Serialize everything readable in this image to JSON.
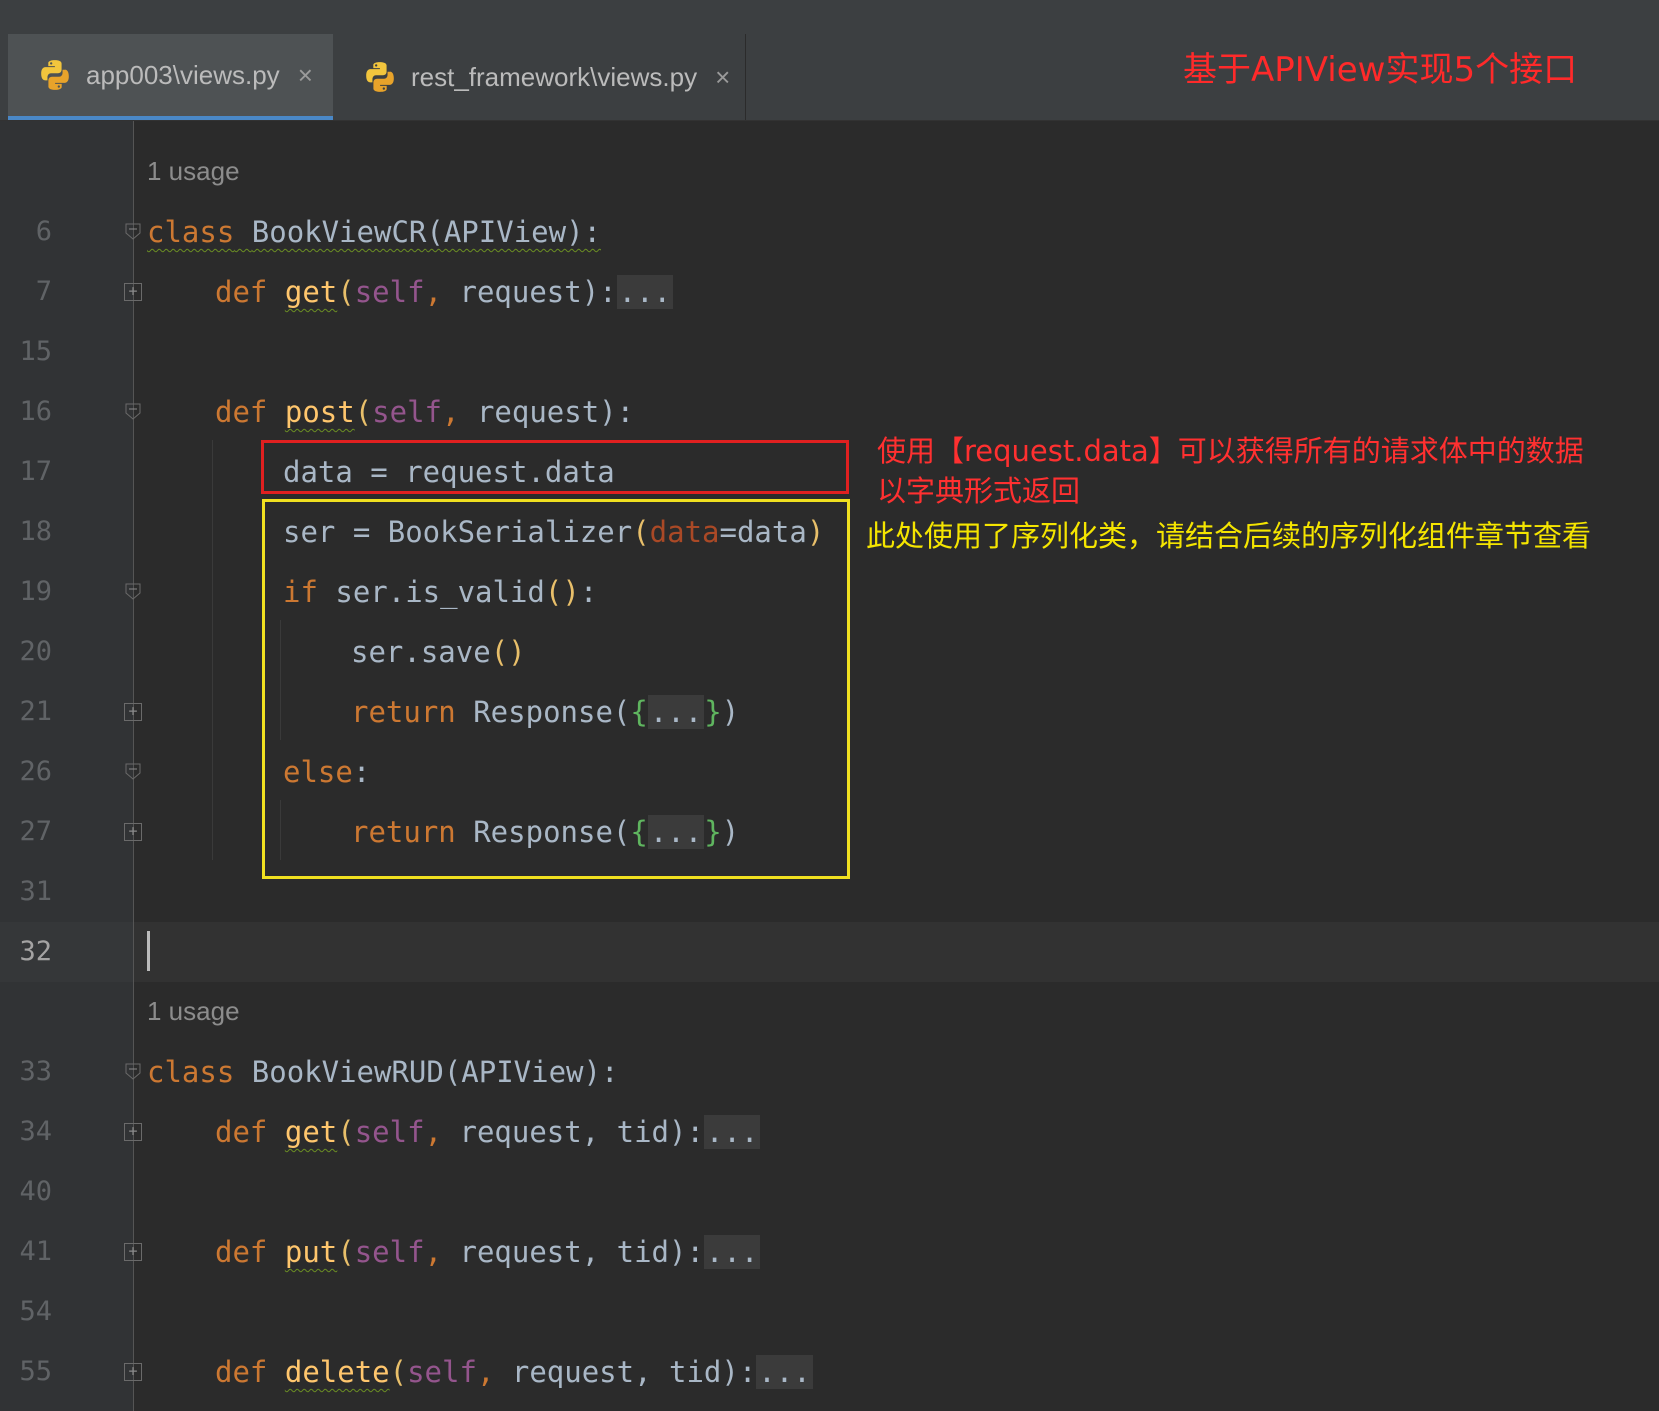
{
  "tabs": [
    {
      "label": "app003\\views.py",
      "close": "×"
    },
    {
      "label": "rest_framework\\views.py",
      "close": "×"
    }
  ],
  "title_note": "基于APIView实现5个接口",
  "usage_hint": "1 usage",
  "line_numbers": [
    "6",
    "7",
    "15",
    "16",
    "17",
    "18",
    "19",
    "20",
    "21",
    "26",
    "27",
    "31",
    "32",
    "33",
    "34",
    "40",
    "41",
    "54",
    "55"
  ],
  "code": {
    "l6": {
      "kw": "class",
      "name": "BookViewCR",
      "base": "(APIView):"
    },
    "l7": {
      "kw": "def",
      "fn": "get",
      "open": "(",
      "self": "self",
      "sep": ", ",
      "args": "request):",
      "ph": "..."
    },
    "l16": {
      "kw": "def",
      "fn": "post",
      "open": "(",
      "self": "self",
      "sep": ", ",
      "args": "request):"
    },
    "l17": "data = request.data",
    "l18": {
      "pre": "ser = BookSerializer",
      "open": "(",
      "param": "data",
      "eq": "=data",
      "close": ")"
    },
    "l19": {
      "kw": "if",
      "rest": " ser.is_valid",
      "parens": "()",
      "colon": ":"
    },
    "l20": {
      "text": "ser.save",
      "parens": "()"
    },
    "l21": {
      "kw": "return",
      "fn": " Response(",
      "lb": "{",
      "ph": "...",
      "rb": "}",
      "end": ")"
    },
    "l26": {
      "kw": "else",
      "colon": ":"
    },
    "l27": {
      "kw": "return",
      "fn": " Response(",
      "lb": "{",
      "ph": "...",
      "rb": "}",
      "end": ")"
    },
    "l33": {
      "kw": "class",
      "name": "BookViewRUD",
      "base": "(APIView):"
    },
    "l34": {
      "kw": "def",
      "fn": "get",
      "open": "(",
      "self": "self",
      "sep": ", ",
      "args": "request, tid):",
      "ph": "..."
    },
    "l41": {
      "kw": "def",
      "fn": "put",
      "open": "(",
      "self": "self",
      "sep": ", ",
      "args": "request, tid):",
      "ph": "..."
    },
    "l55": {
      "kw": "def",
      "fn": "delete",
      "open": "(",
      "self": "self",
      "sep": ", ",
      "args": "request, tid):",
      "ph": "..."
    }
  },
  "notes": {
    "red_line1": "使用【request.data】可以获得所有的请求体中的数据",
    "red_line2": "以字典形式返回",
    "yellow": "此处使用了序列化类，请结合后续的序列化组件章节查看"
  },
  "colors": {
    "annotation_red": "#e02020",
    "annotation_yellow": "#f0e020",
    "keyword": "#cc7832",
    "function": "#ffc66d"
  }
}
